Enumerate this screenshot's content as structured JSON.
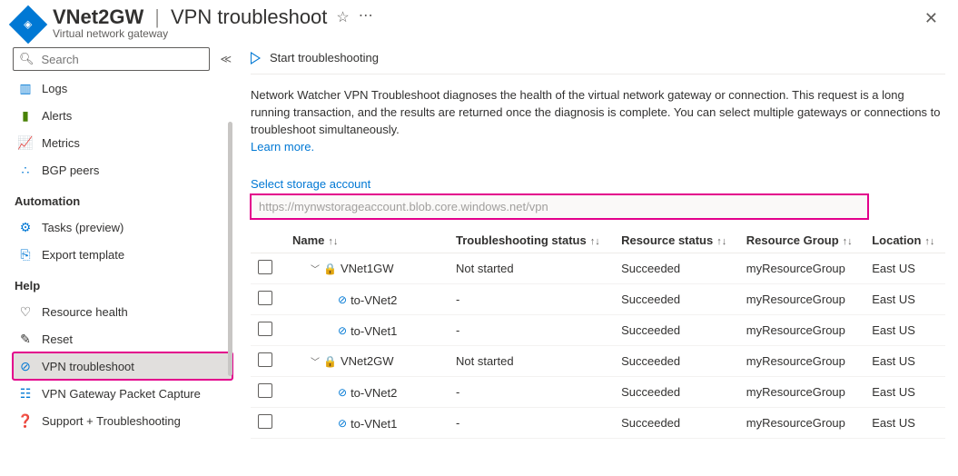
{
  "header": {
    "resource": "VNet2GW",
    "page": "VPN troubleshoot",
    "subtitle": "Virtual network gateway"
  },
  "sidebar": {
    "search_placeholder": "Search",
    "items": {
      "logs": "Logs",
      "alerts": "Alerts",
      "metrics": "Metrics",
      "bgp": "BGP peers",
      "automation_header": "Automation",
      "tasks": "Tasks (preview)",
      "export": "Export template",
      "help_header": "Help",
      "health": "Resource health",
      "reset": "Reset",
      "vpnts": "VPN troubleshoot",
      "capture": "VPN Gateway Packet Capture",
      "support": "Support + Troubleshooting"
    }
  },
  "main": {
    "start_btn": "Start troubleshooting",
    "intro": "Network Watcher VPN Troubleshoot diagnoses the health of the virtual network gateway or connection. This request is a long running transaction, and the results are returned once the diagnosis is complete. You can select multiple gateways or connections to troubleshoot simultaneously.",
    "learn_more": "Learn more.",
    "storage_label": "Select storage account",
    "storage_value": "https://mynwstorageaccount.blob.core.windows.net/vpn",
    "columns": {
      "name": "Name",
      "ts": "Troubleshooting status",
      "rs": "Resource status",
      "rg": "Resource Group",
      "loc": "Location"
    },
    "rows": [
      {
        "type": "gw",
        "name": "VNet1GW",
        "ts": "Not started",
        "rs": "Succeeded",
        "rg": "myResourceGroup",
        "loc": "East US"
      },
      {
        "type": "conn",
        "name": "to-VNet2",
        "ts": "-",
        "rs": "Succeeded",
        "rg": "myResourceGroup",
        "loc": "East US"
      },
      {
        "type": "conn",
        "name": "to-VNet1",
        "ts": "-",
        "rs": "Succeeded",
        "rg": "myResourceGroup",
        "loc": "East US"
      },
      {
        "type": "gw",
        "name": "VNet2GW",
        "ts": "Not started",
        "rs": "Succeeded",
        "rg": "myResourceGroup",
        "loc": "East US"
      },
      {
        "type": "conn",
        "name": "to-VNet2",
        "ts": "-",
        "rs": "Succeeded",
        "rg": "myResourceGroup",
        "loc": "East US"
      },
      {
        "type": "conn",
        "name": "to-VNet1",
        "ts": "-",
        "rs": "Succeeded",
        "rg": "myResourceGroup",
        "loc": "East US"
      }
    ]
  }
}
